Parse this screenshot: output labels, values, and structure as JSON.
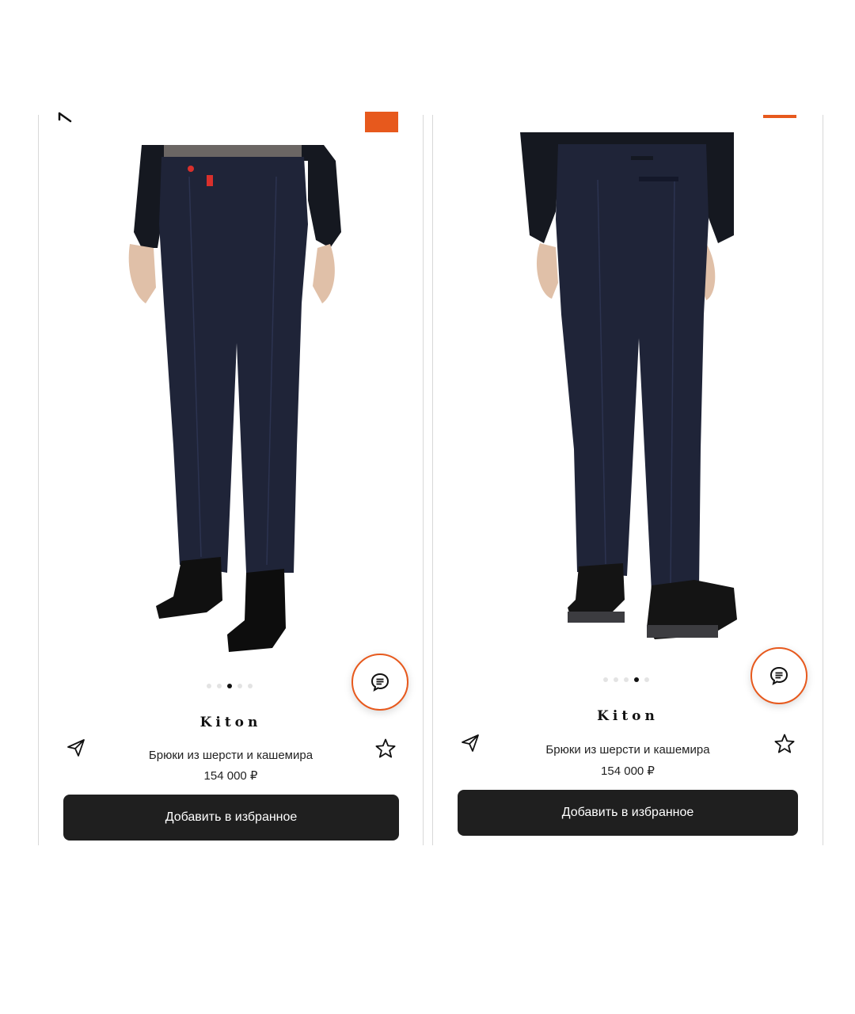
{
  "colors": {
    "accent": "#e7591d",
    "button_bg": "#1f1f1f",
    "trousers": "#1f2438",
    "sweater": "#151820"
  },
  "screens": [
    {
      "brand": "Kiton",
      "title": "Брюки из шерсти и кашемира",
      "price": "154 000 ₽",
      "favorite_label": "Добавить в избранное",
      "gallery": {
        "count": 5,
        "active": 3
      },
      "view": "front",
      "icons": [
        "back-arrow-icon",
        "chat-icon",
        "share-icon",
        "star-icon"
      ]
    },
    {
      "brand": "Kiton",
      "title": "Брюки из шерсти и кашемира",
      "price": "154 000 ₽",
      "favorite_label": "Добавить в избранное",
      "gallery": {
        "count": 5,
        "active": 4
      },
      "view": "back",
      "icons": [
        "chat-icon",
        "share-icon",
        "star-icon"
      ]
    }
  ]
}
